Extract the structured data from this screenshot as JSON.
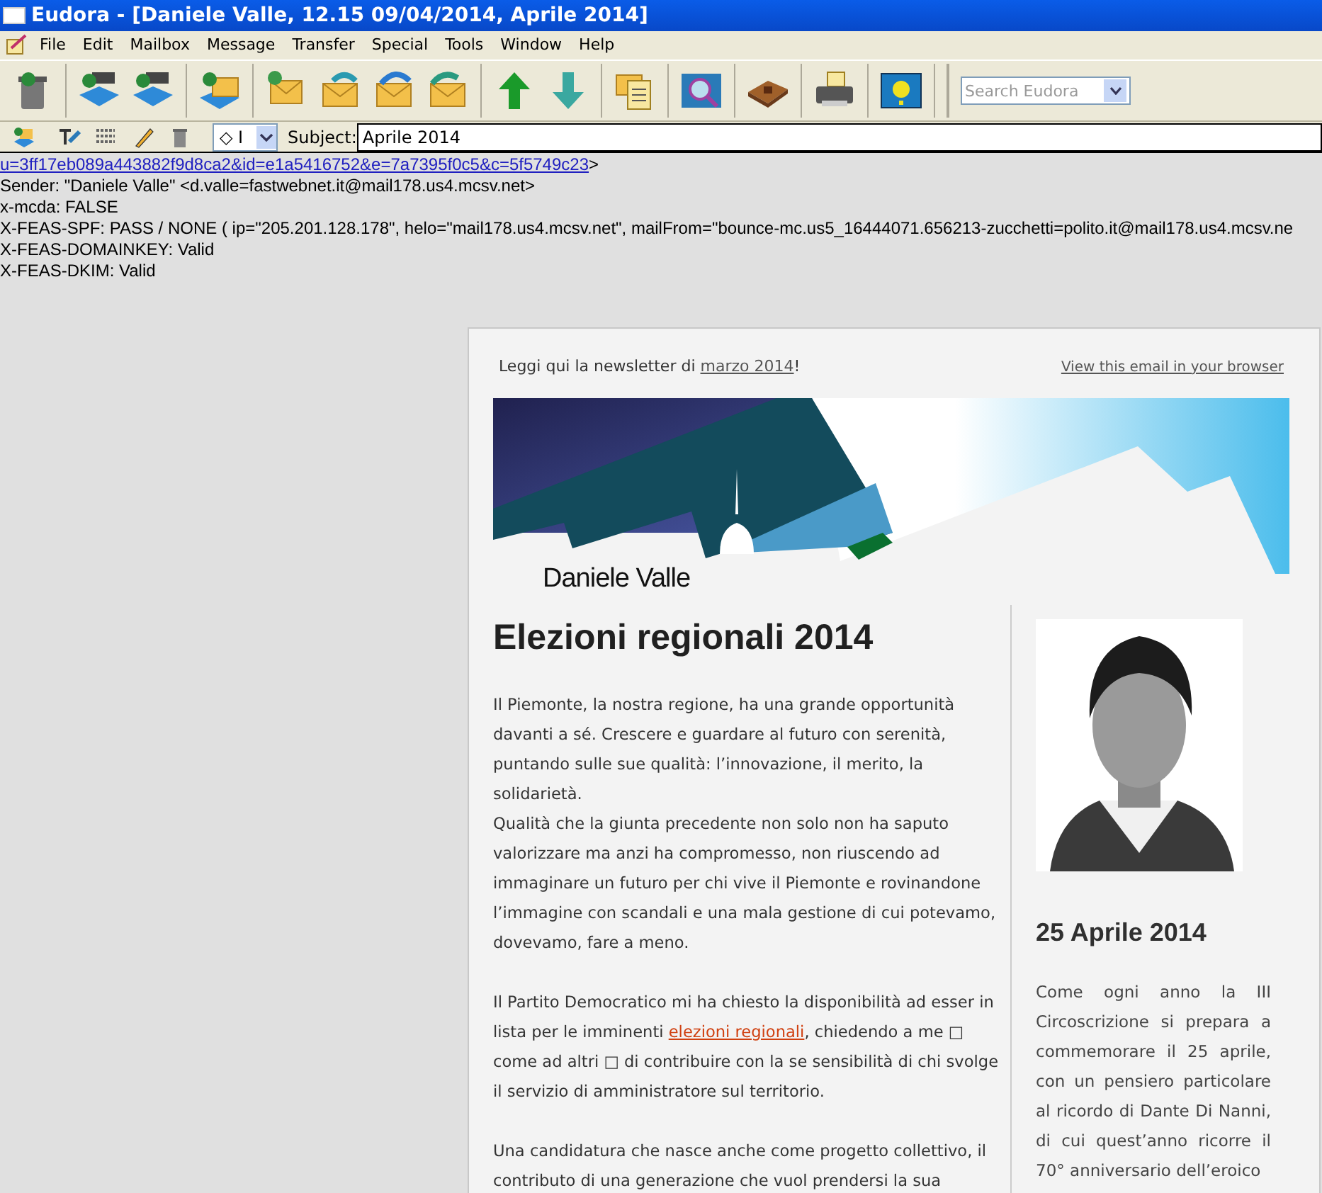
{
  "window": {
    "title": "Eudora - [Daniele Valle, 12.15 09/04/2014, Aprile 2014]"
  },
  "menu": [
    "File",
    "Edit",
    "Mailbox",
    "Message",
    "Transfer",
    "Special",
    "Tools",
    "Window",
    "Help"
  ],
  "search": {
    "placeholder": "Search Eudora"
  },
  "message_toolbar": {
    "priority": "◇ I",
    "subject_label": "Subject:",
    "subject": "Aprile 2014"
  },
  "headers": [
    {
      "kind": "link",
      "text": "u=3ff17eb089a443882f9d8ca2&id=e1a5416752&e=7a7395f0c5&c=5f5749c23",
      "tail": ">"
    },
    {
      "kind": "plain",
      "text": "Sender: \"Daniele Valle\" <d.valle=fastwebnet.it@mail178.us4.mcsv.net>"
    },
    {
      "kind": "plain",
      "text": "x-mcda: FALSE"
    },
    {
      "kind": "plain",
      "text": "X-FEAS-SPF: PASS / NONE ( ip=\"205.201.128.178\", helo=\"mail178.us4.mcsv.net\", mailFrom=\"bounce-mc.us5_16444071.656213-zucchetti=polito.it@mail178.us4.mcsv.ne"
    },
    {
      "kind": "plain",
      "text": "X-FEAS-DOMAINKEY: Valid"
    },
    {
      "kind": "plain",
      "text": "X-FEAS-DKIM: Valid"
    }
  ],
  "newsletter": {
    "intro": "Leggi qui la newsletter di ",
    "intro_link": "marzo 2014",
    "intro_end": "!",
    "browser_link": "View this email in your browser",
    "banner_name": "Daniele Valle",
    "heading": "Elezioni regionali 2014",
    "blocks": [
      [
        [
          {
            "text": "Il Piemonte, la nostra regione, ha una grande opportunità davanti a sé. Crescere e guardare al futuro con serenità, puntando sulle sue qualità: l’innovazione, il merito, la solidarietà."
          }
        ],
        [
          {
            "text": "Qualità che la giunta precedente non solo non ha saputo valorizzare ma anzi ha compromesso, non riuscendo ad immaginare un futuro per chi vive il Piemonte e rovinandone l’immagine con scandali e una mala gestione di cui potevamo, dovevamo, fare a meno."
          }
        ]
      ],
      [
        [
          {
            "text": "Il Partito Democratico mi ha chiesto la disponibilità ad esser in lista per le imminenti "
          },
          {
            "text": "elezioni regionali",
            "link": true
          },
          {
            "text": ", chiedendo a me □ come ad altri □ di contribuire con la se sensibilità di chi svolge il servizio di amministratore sul territorio."
          }
        ]
      ],
      [
        [
          {
            "text": "Una candidatura che nasce anche come progetto collettivo, il contributo di una generazione che vuol prendersi la sua"
          }
        ]
      ]
    ],
    "side_heading": "25 Aprile 2014",
    "side_text": "Come ogni anno la III Circoscrizione si prepara a commemorare il 25 aprile, con un pensiero particolare al ricordo di Dante Di Nanni, di cui quest’anno ricorre il 70° anniversario dell’eroico"
  }
}
